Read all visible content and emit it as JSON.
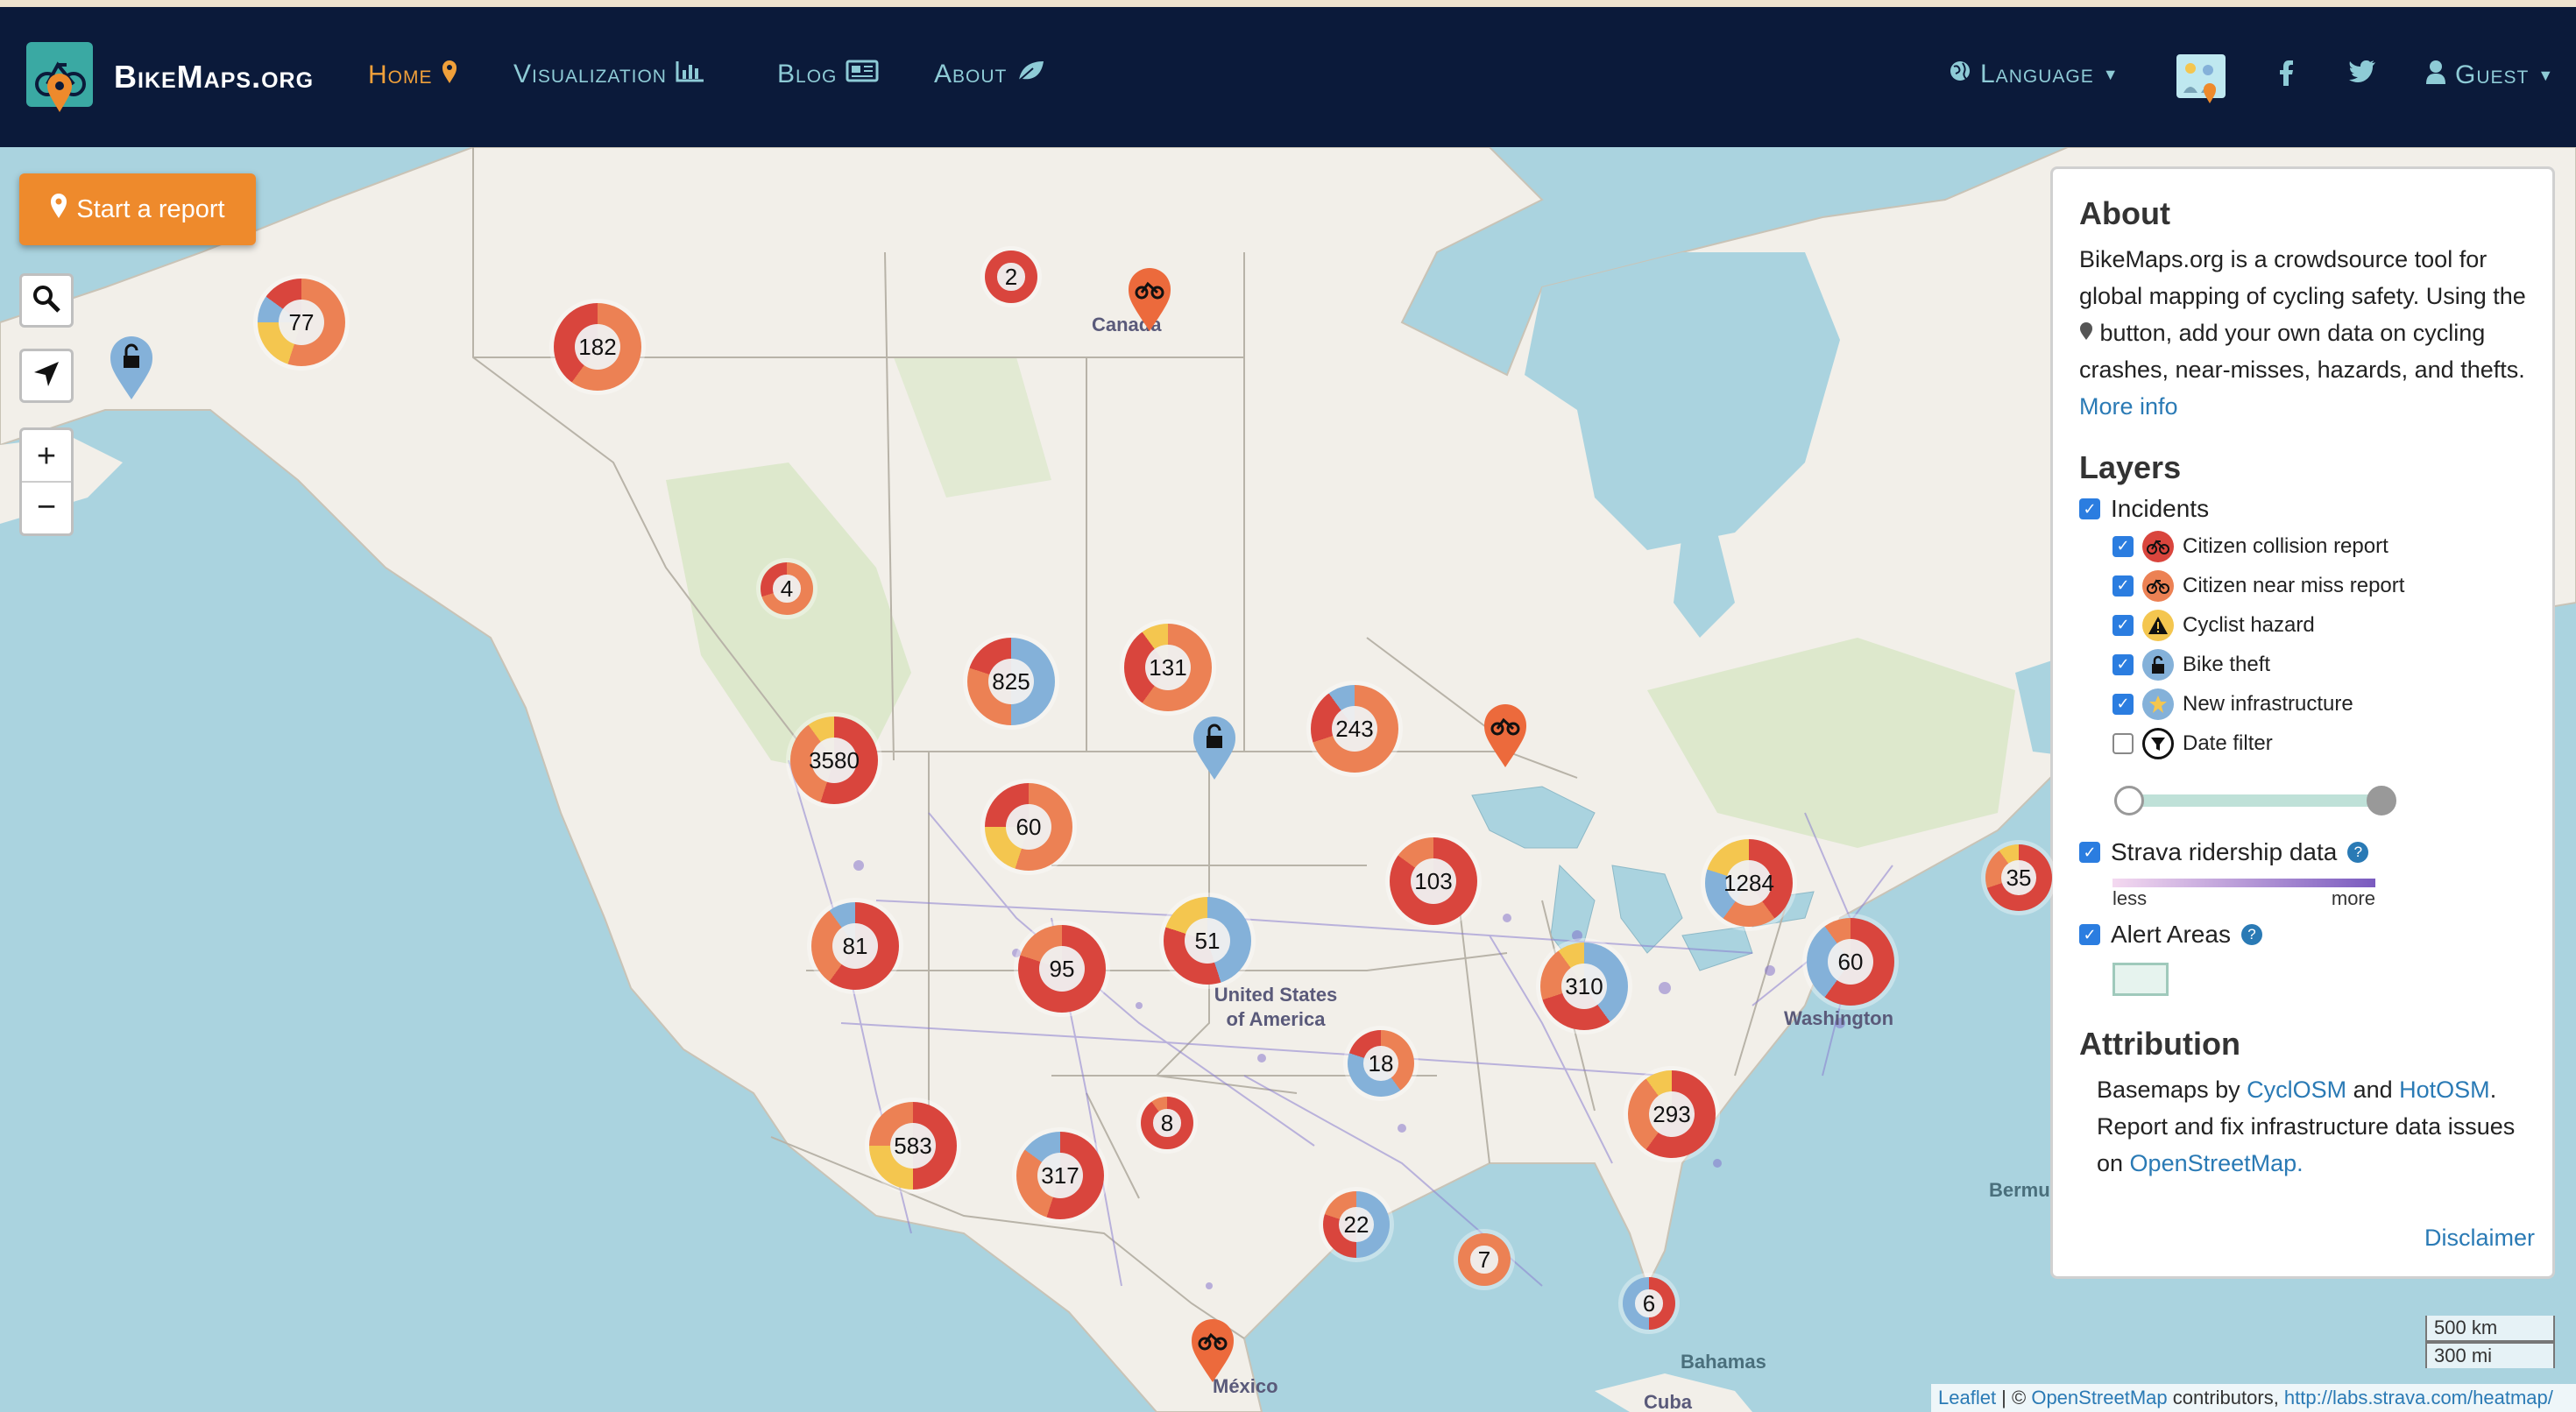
{
  "nav": {
    "brand": "BikeMaps.org",
    "home": "Home",
    "visualization": "Visualization",
    "blog": "Blog",
    "about": "About",
    "language": "Language",
    "guest": "Guest"
  },
  "map": {
    "start_report": "Start a report",
    "zoom_in": "+",
    "zoom_out": "−",
    "places": {
      "canada": "Canada",
      "us": "United States of America",
      "washington": "Washington",
      "bermuda": "Bermuda",
      "bahamas": "Bahamas",
      "mexico": "México",
      "cuba": "Cuba"
    },
    "clusters": [
      "77",
      "182",
      "2",
      "4",
      "825",
      "131",
      "243",
      "3580",
      "60",
      "103",
      "1284",
      "35",
      "81",
      "95",
      "51",
      "310",
      "60",
      "18",
      "8",
      "293",
      "583",
      "317",
      "22",
      "7",
      "6"
    ],
    "scale_km": "500 km",
    "scale_mi": "300 mi",
    "attribution": {
      "leaflet": "Leaflet",
      "sep": " | © ",
      "osm": "OpenStreetMap",
      "contrib": " contributors, ",
      "strava": "http://labs.strava.com/heatmap/"
    }
  },
  "panel": {
    "about_title": "About",
    "about_text_1": "BikeMaps.org is a crowdsource tool for global mapping of cycling safety. Using the",
    "about_text_2": "button, add your own data on cycling crashes, near-misses, hazards, and thefts.",
    "more_info": "More info",
    "layers_title": "Layers",
    "incidents": "Incidents",
    "sub_layers": [
      "Citizen collision report",
      "Citizen near miss report",
      "Cyclist hazard",
      "Bike theft",
      "New infrastructure"
    ],
    "date_filter": "Date filter",
    "strava": "Strava ridership data",
    "less": "less",
    "more": "more",
    "alert_areas": "Alert Areas",
    "attribution_title": "Attribution",
    "basemaps_pre": "Basemaps by ",
    "cyclosm": "CyclOSM",
    "and": " and ",
    "hotosm": "HotOSM",
    "dot": ".",
    "report_fix": "Report and fix infrastructure data issues on ",
    "openstreetmap": "OpenStreetMap.",
    "disclaimer": "Disclaimer"
  },
  "colors": {
    "navbar": "#0b1a3a",
    "accent": "#ee8a2c",
    "collision": "#d9453d",
    "nearmiss": "#ec8154",
    "hazard": "#f4c64f",
    "theft": "#84b1d9"
  }
}
